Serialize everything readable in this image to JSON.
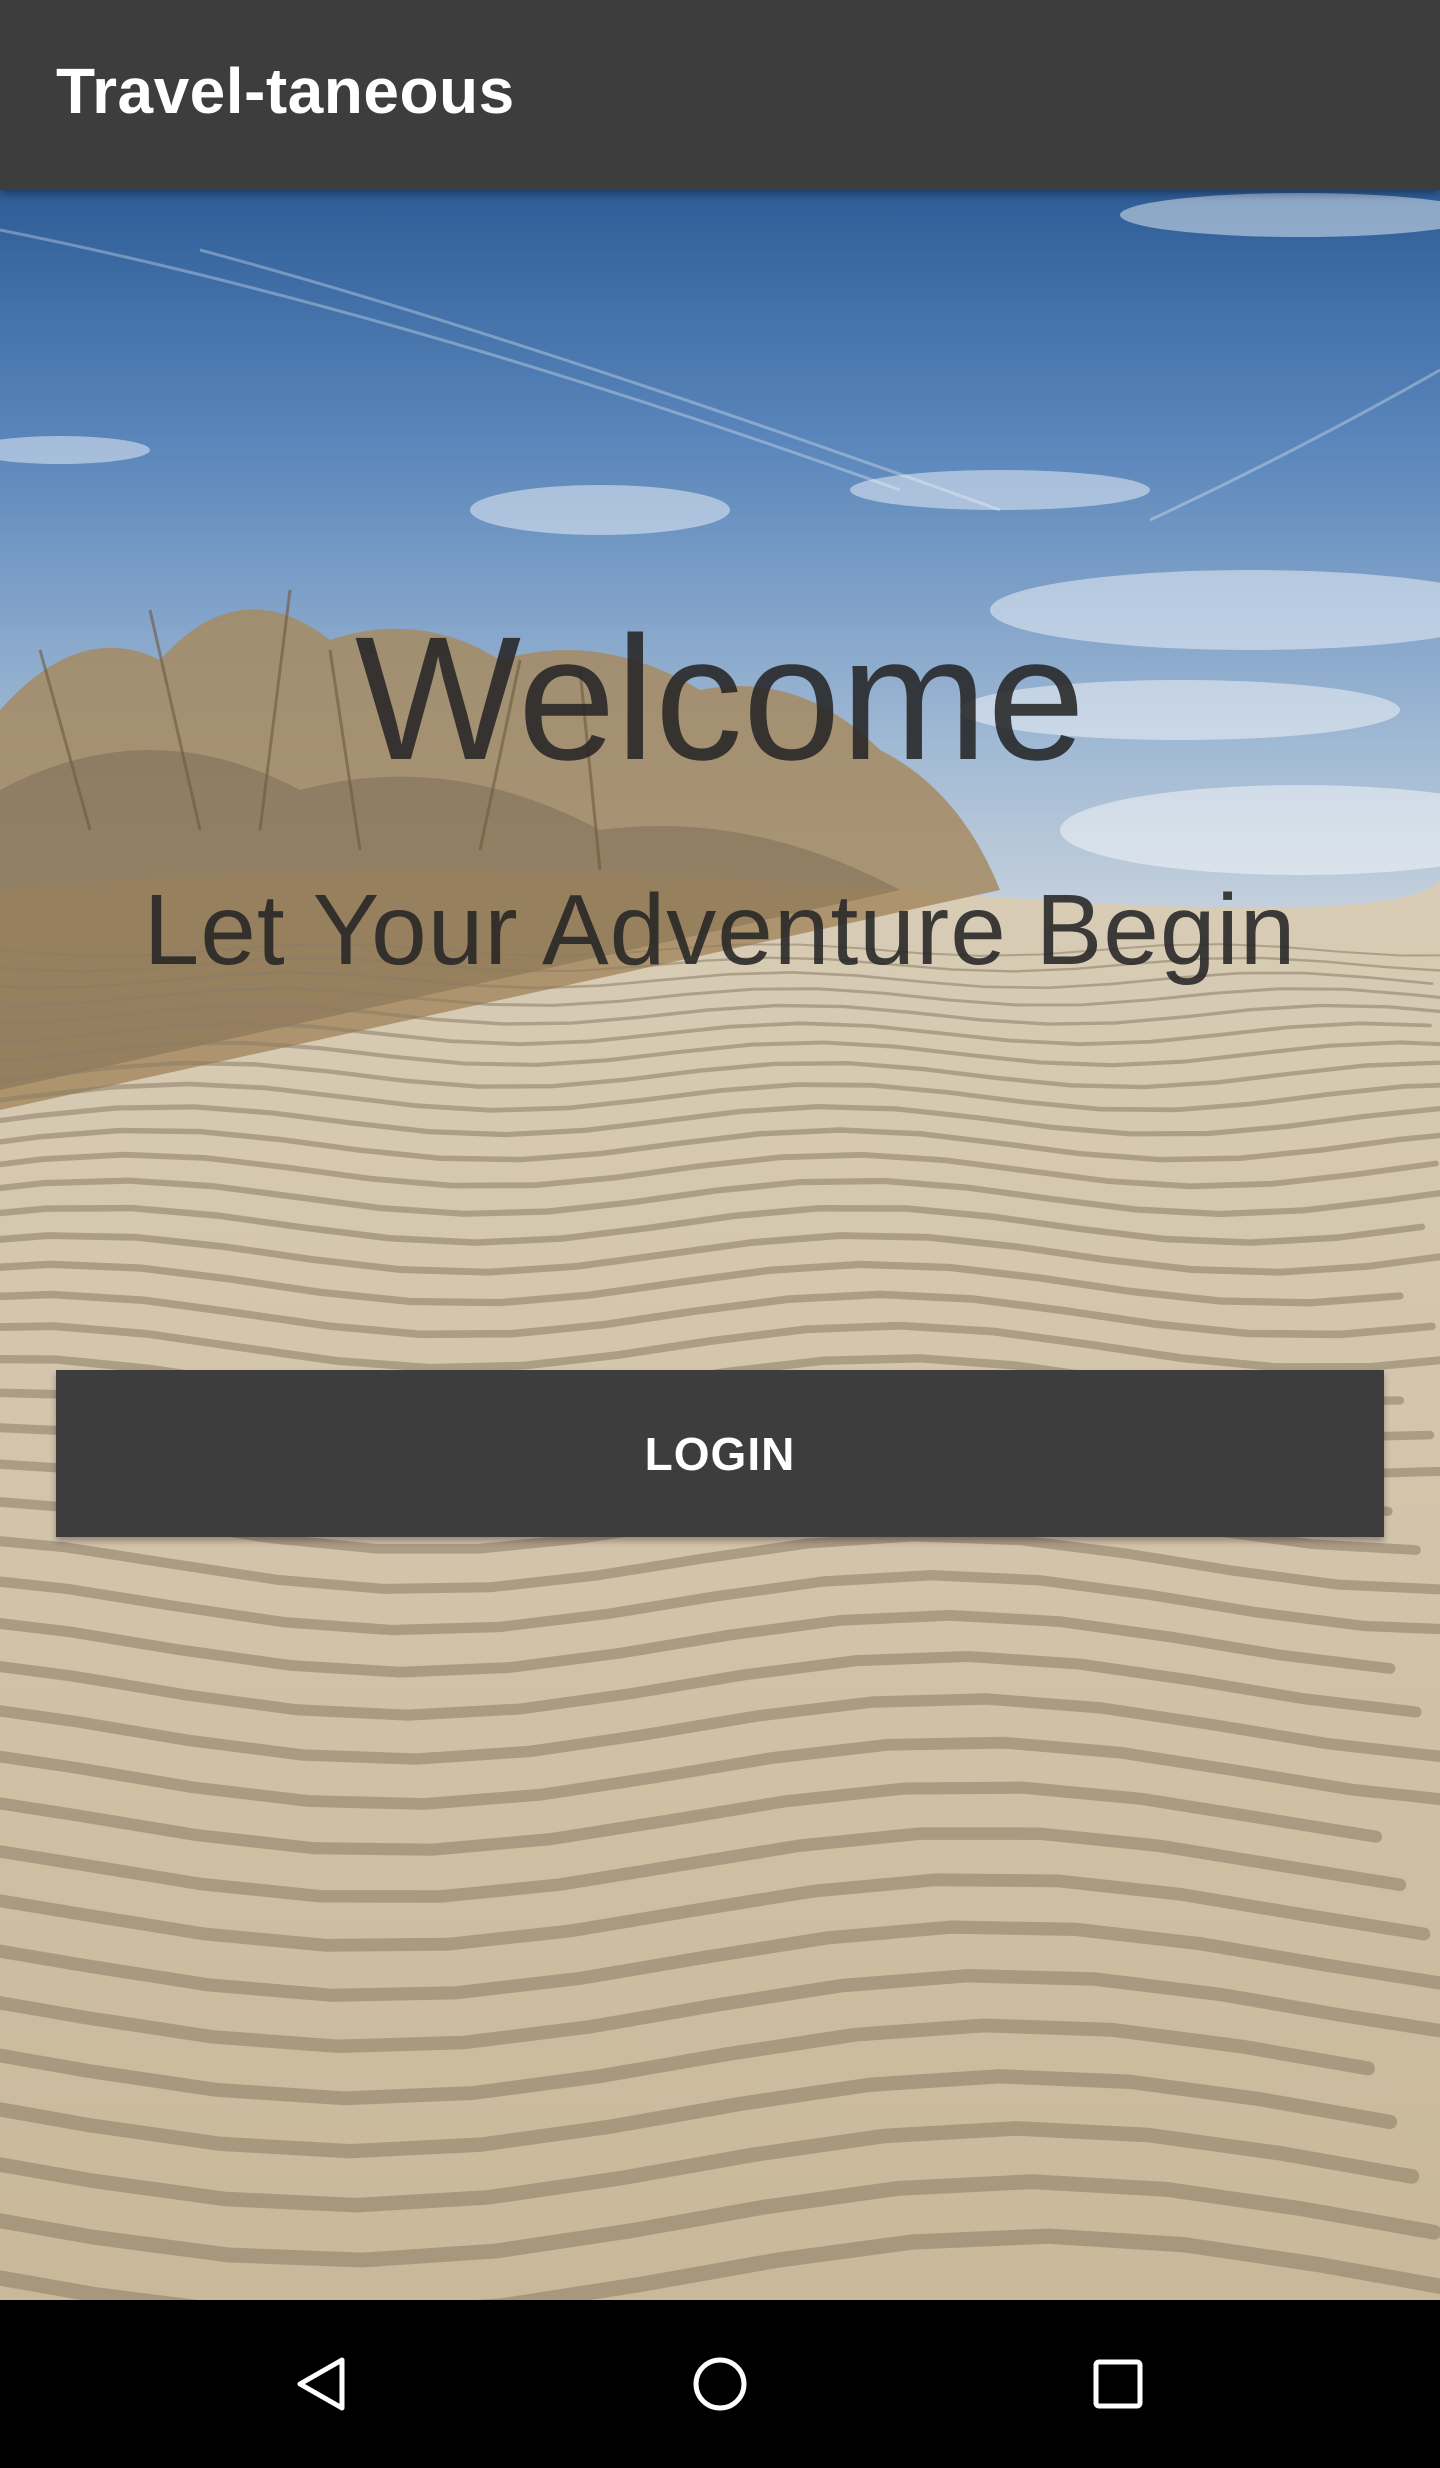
{
  "app_bar": {
    "title": "Travel-taneous",
    "background_color": "#3d3d3d"
  },
  "hero": {
    "welcome_text": "Welcome",
    "tagline_text": "Let Your Adventure Begin",
    "background_scene": "desert sand dunes with dry shrubs under blue sky"
  },
  "login": {
    "label": "LOGIN",
    "background_color": "#3d3d3d"
  },
  "nav_bar": {
    "back_icon": "back-triangle-icon",
    "home_icon": "home-circle-icon",
    "recents_icon": "recents-square-icon"
  }
}
